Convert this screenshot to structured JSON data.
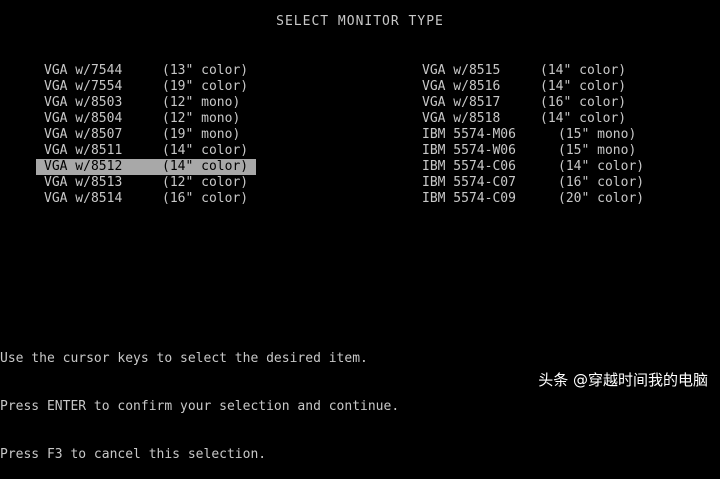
{
  "title": "SELECT MONITOR TYPE",
  "left_list": [
    {
      "name": "VGA w/7544",
      "spec": "(13\" color)"
    },
    {
      "name": "VGA w/7554",
      "spec": "(19\" color)"
    },
    {
      "name": "VGA w/8503",
      "spec": "(12\" mono)"
    },
    {
      "name": "VGA w/8504",
      "spec": "(12\" mono)"
    },
    {
      "name": "VGA w/8507",
      "spec": "(19\" mono)"
    },
    {
      "name": "VGA w/8511",
      "spec": "(14\" color)"
    },
    {
      "name": "VGA w/8512",
      "spec": "(14\" color)"
    },
    {
      "name": "VGA w/8513",
      "spec": "(12\" color)"
    },
    {
      "name": "VGA w/8514",
      "spec": "(16\" color)"
    }
  ],
  "right_list": [
    {
      "name": "VGA w/8515",
      "spec": "(14\" color)"
    },
    {
      "name": "VGA w/8516",
      "spec": "(14\" color)"
    },
    {
      "name": "VGA w/8517",
      "spec": "(16\" color)"
    },
    {
      "name": "VGA w/8518",
      "spec": "(14\" color)"
    },
    {
      "name": "IBM 5574-M06",
      "spec": "(15\" mono)"
    },
    {
      "name": "IBM 5574-W06",
      "spec": "(15\" mono)"
    },
    {
      "name": "IBM 5574-C06",
      "spec": "(14\" color)"
    },
    {
      "name": "IBM 5574-C07",
      "spec": "(16\" color)"
    },
    {
      "name": "IBM 5574-C09",
      "spec": "(20\" color)"
    }
  ],
  "selected": "VGA w/8512",
  "help": [
    "Use the cursor keys to select the desired item.",
    "Press ENTER to confirm your selection and continue.",
    "Press F3 to cancel this selection."
  ],
  "watermark": "头条 @穿越时间我的电脑"
}
